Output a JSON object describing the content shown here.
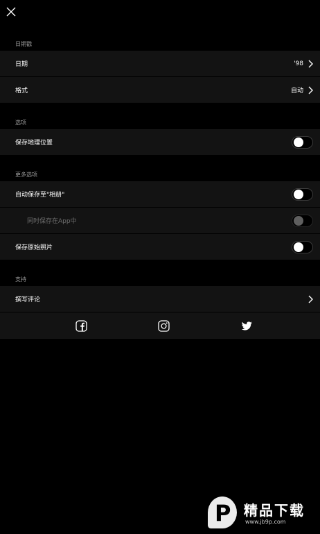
{
  "sections": {
    "datestamp": {
      "header": "日期戳",
      "rows": [
        {
          "label": "日期",
          "value": "'98"
        },
        {
          "label": "格式",
          "value": "自动"
        }
      ]
    },
    "options": {
      "header": "选项",
      "rows": [
        {
          "label": "保存地理位置",
          "toggle": "off"
        }
      ]
    },
    "more_options": {
      "header": "更多选项",
      "rows": [
        {
          "label": "自动保存至\"相册\"",
          "toggle": "off"
        },
        {
          "label": "同时保存在App中",
          "toggle": "disabled"
        },
        {
          "label": "保存原始照片",
          "toggle": "off"
        }
      ]
    },
    "support": {
      "header": "支持",
      "rows": [
        {
          "label": "撰写评论"
        }
      ]
    }
  },
  "social": [
    "facebook-icon",
    "instagram-icon",
    "twitter-icon"
  ],
  "watermark": {
    "text": "精品下载",
    "sub": "www.jb9p.com"
  },
  "colors": {
    "background": "#000000",
    "row_background": "#131313",
    "section_header": "#9a9a9a",
    "text": "#ffffff",
    "dim_text": "#6e6e6e"
  }
}
